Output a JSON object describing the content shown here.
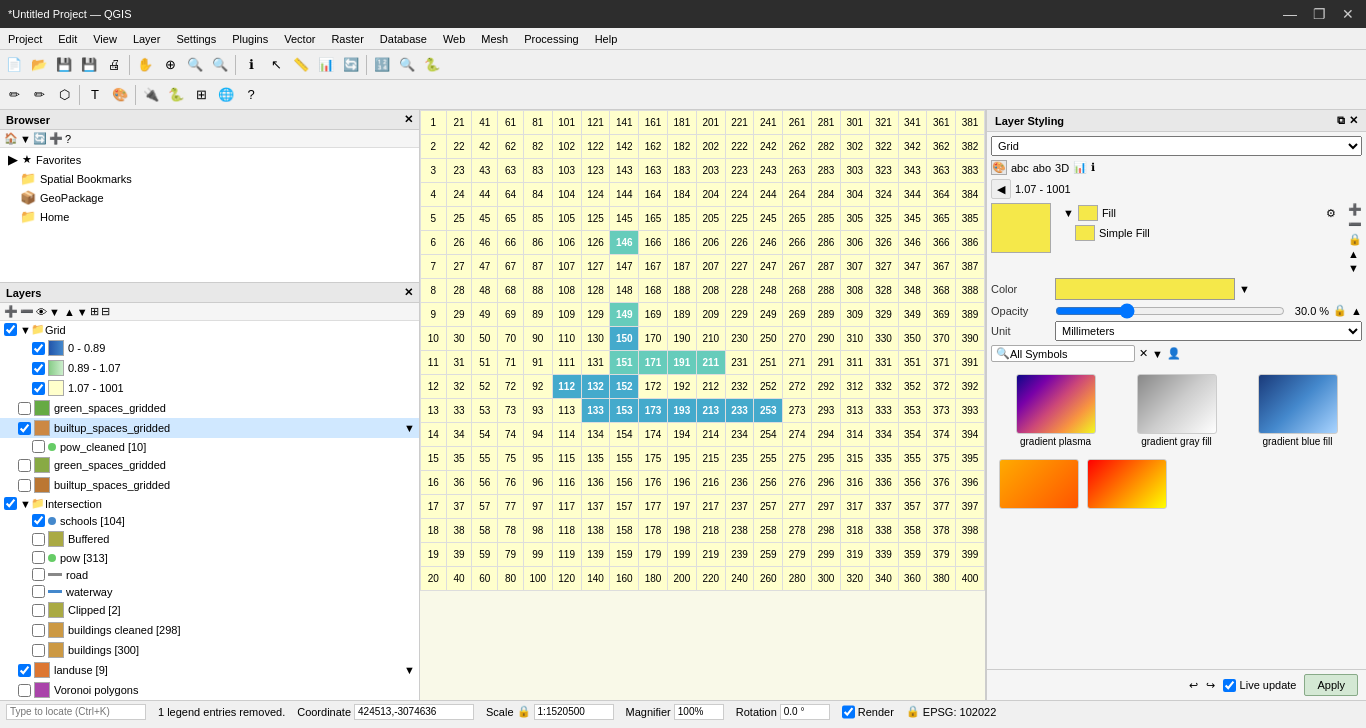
{
  "titlebar": {
    "title": "*Untitled Project — QGIS",
    "minimize": "—",
    "maximize": "❐",
    "close": "✕"
  },
  "menubar": {
    "items": [
      "Project",
      "Edit",
      "View",
      "Layer",
      "Settings",
      "Plugins",
      "Vector",
      "Raster",
      "Database",
      "Web",
      "Mesh",
      "Processing",
      "Help"
    ]
  },
  "browser": {
    "title": "Browser",
    "items": [
      {
        "label": "Favorites",
        "icon": "★",
        "indent": 0
      },
      {
        "label": "Spatial Bookmarks",
        "icon": "📁",
        "indent": 1
      },
      {
        "label": "GeoPackage",
        "icon": "📦",
        "indent": 1
      },
      {
        "label": "Home",
        "icon": "📁",
        "indent": 1
      }
    ]
  },
  "layers": {
    "title": "Layers",
    "items": [
      {
        "label": "Grid",
        "type": "group",
        "checked": true,
        "indent": 0
      },
      {
        "label": "0 - 0.89",
        "type": "range",
        "color1": "#4488cc",
        "color2": "#88bbdd",
        "checked": true,
        "indent": 2
      },
      {
        "label": "0.89 - 1.07",
        "type": "range",
        "color1": "#aaccaa",
        "color2": "#cceecc",
        "checked": true,
        "indent": 2
      },
      {
        "label": "1.07 - 1001",
        "type": "range",
        "color1": "#eeee88",
        "color2": "#ffffcc",
        "checked": true,
        "indent": 2
      },
      {
        "label": "green_spaces_gridded",
        "type": "polygon",
        "color": "#66aa44",
        "checked": false,
        "indent": 1
      },
      {
        "label": "builtup_spaces_gridded",
        "type": "polygon",
        "color": "#cc8844",
        "checked": true,
        "indent": 1
      },
      {
        "label": "pow_cleaned [10]",
        "type": "point",
        "color": "#66cc66",
        "checked": false,
        "indent": 2
      },
      {
        "label": "green_spaces_gridded",
        "type": "polygon",
        "color": "#88aa44",
        "checked": false,
        "indent": 1
      },
      {
        "label": "builtup_spaces_gridded",
        "type": "polygon",
        "color": "#bb7733",
        "checked": false,
        "indent": 1
      },
      {
        "label": "Intersection",
        "type": "group",
        "checked": true,
        "indent": 0
      },
      {
        "label": "schools [104]",
        "type": "point",
        "color": "#4488cc",
        "checked": true,
        "indent": 2
      },
      {
        "label": "Buffered",
        "type": "polygon",
        "color": "#aaaa44",
        "checked": false,
        "indent": 2
      },
      {
        "label": "pow [313]",
        "type": "point",
        "color": "#66cc66",
        "checked": false,
        "indent": 2
      },
      {
        "label": "road",
        "type": "line",
        "color": "#888888",
        "checked": false,
        "indent": 2
      },
      {
        "label": "waterway",
        "type": "line",
        "color": "#4488cc",
        "checked": false,
        "indent": 2
      },
      {
        "label": "Clipped [2]",
        "type": "polygon",
        "color": "#aaaa44",
        "checked": false,
        "indent": 2
      },
      {
        "label": "buildings cleaned [298]",
        "type": "polygon",
        "color": "#cc9944",
        "checked": false,
        "indent": 2
      },
      {
        "label": "buildings [300]",
        "type": "polygon",
        "color": "#cc9944",
        "checked": false,
        "indent": 2
      },
      {
        "label": "landuse [9]",
        "type": "polygon",
        "color": "#dd7733",
        "checked": true,
        "indent": 1
      },
      {
        "label": "Voronoi polygons",
        "type": "polygon",
        "color": "#aa44aa",
        "checked": false,
        "indent": 1
      }
    ]
  },
  "grid": {
    "rows": [
      [
        1,
        21,
        41,
        61,
        81,
        101,
        121,
        141,
        161,
        181,
        201,
        221,
        241,
        261,
        281,
        301,
        321,
        341,
        361,
        381
      ],
      [
        2,
        22,
        42,
        62,
        82,
        102,
        122,
        142,
        162,
        182,
        202,
        222,
        242,
        262,
        282,
        302,
        322,
        342,
        362,
        382
      ],
      [
        3,
        23,
        43,
        63,
        83,
        103,
        123,
        143,
        163,
        183,
        203,
        223,
        243,
        263,
        283,
        303,
        323,
        343,
        363,
        383
      ],
      [
        4,
        24,
        44,
        64,
        84,
        104,
        124,
        144,
        164,
        184,
        204,
        224,
        244,
        264,
        284,
        304,
        324,
        344,
        364,
        384
      ],
      [
        5,
        25,
        45,
        65,
        85,
        105,
        125,
        145,
        165,
        185,
        205,
        225,
        245,
        265,
        285,
        305,
        325,
        345,
        365,
        385
      ],
      [
        6,
        26,
        46,
        66,
        86,
        106,
        126,
        146,
        166,
        186,
        206,
        226,
        246,
        266,
        286,
        306,
        326,
        346,
        366,
        386
      ],
      [
        7,
        27,
        47,
        67,
        87,
        107,
        127,
        147,
        167,
        187,
        207,
        227,
        247,
        267,
        287,
        307,
        327,
        347,
        367,
        387
      ],
      [
        8,
        28,
        48,
        68,
        88,
        108,
        128,
        148,
        168,
        188,
        208,
        228,
        248,
        268,
        288,
        308,
        328,
        348,
        368,
        388
      ],
      [
        9,
        29,
        49,
        69,
        89,
        109,
        129,
        149,
        169,
        189,
        209,
        229,
        249,
        269,
        289,
        309,
        329,
        349,
        369,
        389
      ],
      [
        10,
        30,
        50,
        70,
        90,
        110,
        130,
        150,
        170,
        190,
        210,
        230,
        250,
        270,
        290,
        310,
        330,
        350,
        370,
        390
      ],
      [
        11,
        31,
        51,
        71,
        91,
        111,
        131,
        151,
        171,
        191,
        211,
        231,
        251,
        271,
        291,
        311,
        331,
        351,
        371,
        391
      ],
      [
        12,
        32,
        52,
        72,
        92,
        112,
        132,
        152,
        172,
        192,
        212,
        232,
        252,
        272,
        292,
        312,
        332,
        352,
        372,
        392
      ],
      [
        13,
        33,
        53,
        73,
        93,
        113,
        133,
        153,
        173,
        193,
        213,
        233,
        253,
        273,
        293,
        313,
        333,
        353,
        373,
        393
      ],
      [
        14,
        34,
        54,
        74,
        94,
        114,
        134,
        154,
        174,
        194,
        214,
        234,
        254,
        274,
        294,
        314,
        334,
        354,
        374,
        394
      ],
      [
        15,
        35,
        55,
        75,
        95,
        115,
        135,
        155,
        175,
        195,
        215,
        235,
        255,
        275,
        295,
        315,
        335,
        355,
        375,
        395
      ],
      [
        16,
        36,
        56,
        76,
        96,
        116,
        136,
        156,
        176,
        196,
        216,
        236,
        256,
        276,
        296,
        316,
        336,
        356,
        376,
        396
      ],
      [
        17,
        37,
        57,
        77,
        97,
        117,
        137,
        157,
        177,
        197,
        217,
        237,
        257,
        277,
        297,
        317,
        337,
        357,
        377,
        397
      ],
      [
        18,
        38,
        58,
        78,
        98,
        118,
        138,
        158,
        178,
        198,
        218,
        238,
        258,
        278,
        298,
        318,
        338,
        358,
        378,
        398
      ],
      [
        19,
        39,
        59,
        79,
        99,
        119,
        139,
        159,
        179,
        199,
        219,
        239,
        259,
        279,
        299,
        319,
        339,
        359,
        379,
        399
      ],
      [
        20,
        40,
        60,
        80,
        100,
        120,
        140,
        160,
        180,
        200,
        220,
        240,
        260,
        280,
        300,
        320,
        340,
        360,
        380,
        400
      ]
    ],
    "highlighted_cells": [
      {
        "row": 5,
        "col": 7,
        "bg": "#66ccbb"
      },
      {
        "row": 9,
        "col": 7,
        "bg": "#66ccbb"
      },
      {
        "row": 10,
        "col": 7,
        "bg": "#44aacc"
      },
      {
        "row": 11,
        "col": 8,
        "bg": "#66ccbb"
      },
      {
        "row": 11,
        "col": 9,
        "bg": "#66ccbb"
      },
      {
        "row": 11,
        "col": 10,
        "bg": "#66ccbb"
      },
      {
        "row": 12,
        "col": 6,
        "bg": "#44aacc"
      },
      {
        "row": 12,
        "col": 7,
        "bg": "#44aacc"
      }
    ]
  },
  "styling": {
    "title": "Layer Styling",
    "layer_name": "Grid",
    "nav_prev": "◀",
    "nav_range": "1.07 - 1001",
    "fill_label": "Fill",
    "simple_fill_label": "Simple Fill",
    "color_label": "Color",
    "color_value": "#f5e84a",
    "opacity_label": "Opacity",
    "opacity_value": "30.0 %",
    "unit_label": "Unit",
    "unit_value": "Millimeters",
    "search_placeholder": "All Symbols",
    "symbols": [
      {
        "label": "gradient plasma",
        "type": "gradient-plasma"
      },
      {
        "label": "gradient gray fill",
        "type": "gradient-gray"
      },
      {
        "label": "gradient blue fill",
        "type": "gradient-blue"
      }
    ],
    "apply_label": "Apply",
    "live_update_label": "Live update"
  },
  "statusbar": {
    "message": "1 legend entries removed.",
    "coordinate_label": "Coordinate",
    "coordinate_value": "424513,-3074636",
    "scale_label": "Scale",
    "scale_value": "1:1520500",
    "magnifier_label": "Magnifier",
    "magnifier_value": "100%",
    "rotation_label": "Rotation",
    "rotation_value": "0.0 °",
    "render_label": "Render",
    "crs_label": "EPSG: 102022",
    "search_placeholder": "Type to locate (Ctrl+K)"
  }
}
